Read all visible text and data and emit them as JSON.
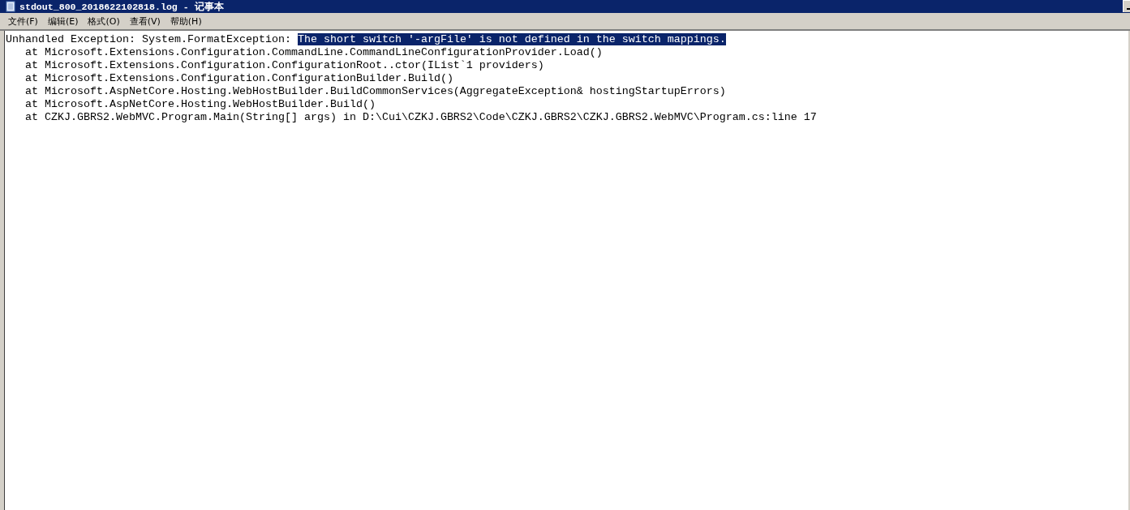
{
  "window": {
    "title": "stdout_800_2018622102818.log - 记事本"
  },
  "menu": [
    {
      "label": "文件(F)"
    },
    {
      "label": "编辑(E)"
    },
    {
      "label": "格式(O)"
    },
    {
      "label": "查看(V)"
    },
    {
      "label": "帮助(H)"
    }
  ],
  "document": {
    "lines": [
      {
        "text": "Unhandled Exception: System.FormatException: ",
        "selection": "The short switch '-argFile' is not defined in the switch mappings."
      },
      {
        "text": "   at Microsoft.Extensions.Configuration.CommandLine.CommandLineConfigurationProvider.Load()"
      },
      {
        "text": "   at Microsoft.Extensions.Configuration.ConfigurationRoot..ctor(IList`1 providers)"
      },
      {
        "text": "   at Microsoft.Extensions.Configuration.ConfigurationBuilder.Build()"
      },
      {
        "text": "   at Microsoft.AspNetCore.Hosting.WebHostBuilder.BuildCommonServices(AggregateException& hostingStartupErrors)"
      },
      {
        "text": "   at Microsoft.AspNetCore.Hosting.WebHostBuilder.Build()"
      },
      {
        "text": "   at CZKJ.GBRS2.WebMVC.Program.Main(String[] args) in D:\\Cui\\CZKJ.GBRS2\\Code\\CZKJ.GBRS2\\CZKJ.GBRS2.WebMVC\\Program.cs:line 17"
      }
    ]
  }
}
